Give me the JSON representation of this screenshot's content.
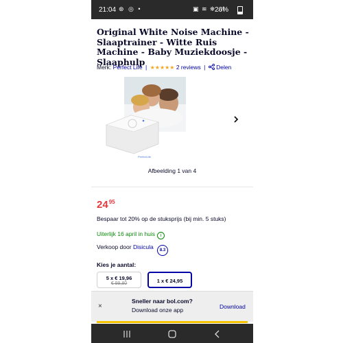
{
  "status_bar": {
    "time": "21:04",
    "left_icons": "⊛ ◎ •",
    "right_icons": "▣ ≋ ⛯ .ıl",
    "battery": "26%"
  },
  "product": {
    "title": "Original White Noise Machine - Slaaptrainer - Witte Ruis Machine - Baby Muziekdoosje - Slaaphulp",
    "brand_label": "Merk:",
    "brand": "Perfect Life",
    "stars": "★★★★★",
    "reviews": "2 reviews",
    "share": "Delen",
    "image_watermark": "PerfectLife",
    "image_caption": "Afbeelding 1 van 4"
  },
  "pricing": {
    "price_main": "24",
    "price_cents": "95",
    "discount_text": "Bespaar tot 20% op de stuksprijs  (bij min. 5 stuks)",
    "delivery": "Uiterlijk 16 april in huis",
    "seller_label": "Verkoop door",
    "seller": "Disicula",
    "seller_rating": "8.3",
    "quantity_label": "Kies je aantal:",
    "options": [
      {
        "line1": "5 x € 19,96",
        "line2": "€ 99,80"
      },
      {
        "line1": "1 x € 24,95",
        "line2": ""
      }
    ]
  },
  "banner": {
    "close": "×",
    "title": "Sneller naar bol.com?",
    "subtitle": "Download onze app",
    "action": "Download"
  },
  "colors": {
    "price": "#e0393e",
    "link": "#0000a4",
    "delivery": "#0c8a0c",
    "stars": "#f5a623",
    "status_bar": "#2a2a2a",
    "accent_bar": "#f3c300"
  },
  "icons": [
    "info-icon",
    "share-icon",
    "chevron-right-icon",
    "close-icon",
    "nav-recent-icon",
    "nav-home-icon",
    "nav-back-icon"
  ]
}
